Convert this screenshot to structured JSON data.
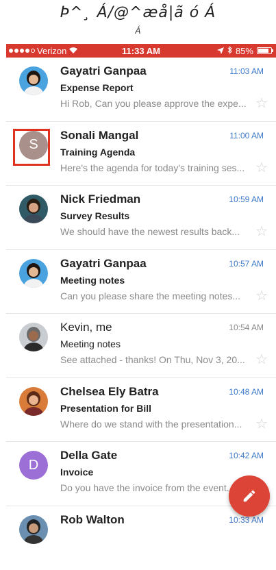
{
  "header_garble": {
    "line1": "Þ^¸ Á/@^æå|ã ó Á",
    "line2": "Á"
  },
  "status_bar": {
    "carrier": "Verizon",
    "time": "11:33 AM",
    "battery": "85%",
    "battery_level": 0.85,
    "bar_color": "#d8392f"
  },
  "emails": [
    {
      "sender": "Gayatri Ganpaa",
      "subject": "Expense Report",
      "preview": "Hi Rob, Can you please approve the expe...",
      "time": "11:03 AM",
      "unread": true,
      "avatar": "photo-woman"
    },
    {
      "sender": "Sonali Mangal",
      "subject": "Training Agenda",
      "preview": "Here's the agenda for today's training ses...",
      "time": "11:00 AM",
      "unread": true,
      "avatar": "letter",
      "initial": "S",
      "avatar_color": "#a9908a",
      "highlighted": true
    },
    {
      "sender": "Nick Friedman",
      "subject": "Survey Results",
      "preview": "We should have the newest results back...",
      "time": "10:59 AM",
      "unread": true,
      "avatar": "photo-man"
    },
    {
      "sender": "Gayatri Ganpaa",
      "subject": "Meeting notes",
      "preview": "Can you please share the meeting notes...",
      "time": "10:57 AM",
      "unread": true,
      "avatar": "photo-woman"
    },
    {
      "sender": "Kevin, me",
      "subject": "Meeting notes",
      "preview": "See attached - thanks! On Thu, Nov 3, 20...",
      "time": "10:54 AM",
      "unread": false,
      "avatar": "photo-older-man"
    },
    {
      "sender": "Chelsea Ely Batra",
      "subject": "Presentation for Bill",
      "preview": "Where do we stand with the presentation...",
      "time": "10:48 AM",
      "unread": true,
      "avatar": "photo-woman-smile"
    },
    {
      "sender": "Della Gate",
      "subject": "Invoice",
      "preview": "Do you have the invoice from the event...",
      "time": "10:42 AM",
      "unread": true,
      "avatar": "letter",
      "initial": "D",
      "avatar_color": "#9c6fd6"
    },
    {
      "sender": "Rob Walton",
      "subject": "",
      "preview": "",
      "time": "10:33 AM",
      "unread": true,
      "avatar": "photo-man-partial"
    }
  ],
  "colors": {
    "accent": "#3c78c8",
    "fab": "#db4437",
    "highlight_box": "#e0301e"
  },
  "icons": {
    "fab": "pencil-icon",
    "star": "star-outline-icon"
  }
}
